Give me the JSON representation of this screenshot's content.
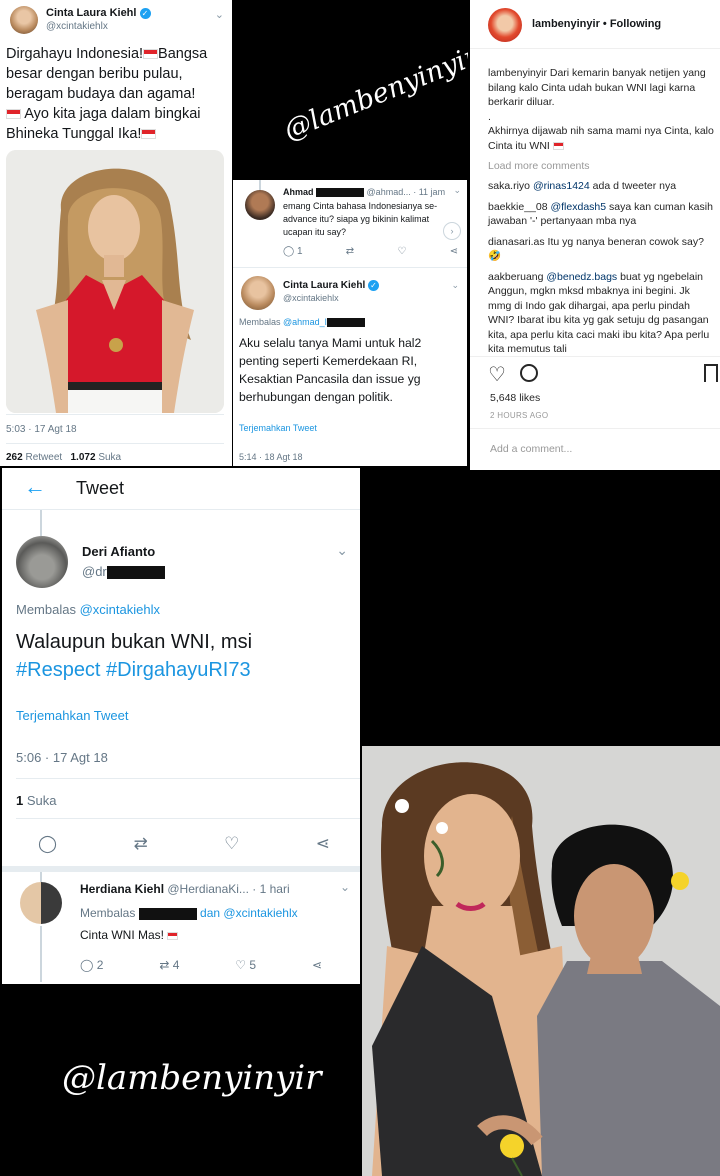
{
  "colors": {
    "twitter_blue": "#1b95e0",
    "flag_red": "#e0242a",
    "instagram_link": "#003569"
  },
  "tweet_main": {
    "name": "Cinta Laura Kiehl",
    "handle": "@xcintakiehlx",
    "text": "Dirgahayu Indonesia! Bangsa besar dengan beribu pulau, beragam budaya dan agama! Ayo kita jaga dalam bingkai Bhineka Tunggal Ika!",
    "lines": [
      "Dirgahayu Indonesia!",
      "Bangsa",
      "besar dengan beribu pulau,",
      "beragam budaya dan agama!",
      "Ayo kita jaga dalam bingkai",
      "Bhineka Tunggal Ika!"
    ],
    "time": "5:03 · 17 Agt 18",
    "retweets_count": "262",
    "retweets_label": "Retweet",
    "likes_count": "1.072",
    "likes_label": "Suka"
  },
  "watermark": "@lambenyinyir",
  "reply_thread": {
    "first": {
      "name": "Ahmad",
      "handle": "@ahmad...",
      "time": "· 11 jam",
      "text": "emang Cinta bahasa Indonesianya se-advance itu? siapa yg bikinin kalimat ucapan itu say?",
      "reply_count": "1"
    },
    "second": {
      "name": "Cinta Laura Kiehl",
      "handle": "@xcintakiehlx",
      "replying_label": "Membalas",
      "replying_to": "@ahmad_l",
      "text": "Aku selalu tanya Mami untuk hal2 penting seperti Kemerdekaan RI, Kesaktian Pancasila dan issue yg berhubungan dengan politik.",
      "translate": "Terjemahkan Tweet",
      "time": "5:14 · 18 Agt 18"
    }
  },
  "instagram": {
    "username": "lambenyinyir",
    "following": "• Following",
    "caption_user": "lambenyinyir",
    "caption": "Dari kemarin banyak netijen yang bilang kalo Cinta udah bukan WNI lagi karna berkarir diluar.",
    "caption_dot": ".",
    "caption2": "Akhirnya dijawab nih sama mami nya Cinta, kalo Cinta itu WNI",
    "load_more": "Load more comments",
    "comments": [
      {
        "user": "saka.riyo",
        "mention": "@rinas1424",
        "text": "ada d tweeter nya"
      },
      {
        "user": "baekkie__08",
        "mention": "@flexdash5",
        "text": "saya kan cuman kasih jawaban '-' pertanyaan mba nya"
      },
      {
        "user": "dianasari.as",
        "mention": "",
        "text": "Itu yg nanya beneran cowok say? 🤣"
      },
      {
        "user": "aakberuang",
        "mention": "@benedz.bags",
        "text": "buat yg ngebelain Anggun, mgkn mksd mbaknya ini begini. Jk mmg di Indo gak dihargai, apa perlu pindah WNI? Ibarat ibu kita yg gak setuju dg pasangan kita, apa perlu kita caci maki ibu kita? Apa perlu kita memutus tali"
      }
    ],
    "likes": "5,648 likes",
    "time": "2 HOURS AGO",
    "add_comment": "Add a comment..."
  },
  "tweet_screen": {
    "header": "Tweet",
    "author_name": "Deri Afianto",
    "author_handle": "@dr",
    "replying_label": "Membalas",
    "replying_to": "@xcintakiehlx",
    "text_line1": "Walaupun bukan WNI, msi",
    "hashtags": "#Respect #DirgahayuRI73",
    "translate": "Terjemahkan Tweet",
    "time": "5:06 · 17 Agt 18",
    "likes_count": "1",
    "likes_label": "Suka",
    "reply": {
      "name": "Herdiana Kiehl",
      "handle": "@HerdianaKi...",
      "time": "· 1 hari",
      "replying_label": "Membalas",
      "conj": "dan",
      "replying_to": "@xcintakiehlx",
      "text": "Cinta WNI Mas!",
      "reply_count": "2",
      "retweet_count": "4",
      "like_count": "5"
    }
  }
}
